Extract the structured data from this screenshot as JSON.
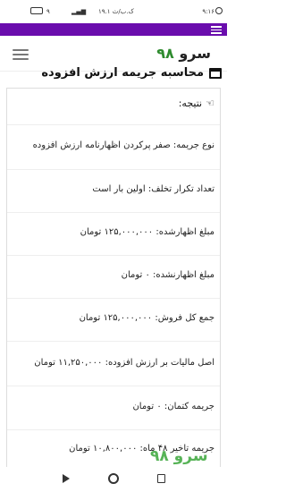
{
  "status_bar": {
    "time": "۹:۱۶",
    "network_speed": "۱۹.۱ ک.ب/ث",
    "battery": "۹"
  },
  "header": {
    "logo_text": "سرو",
    "logo_number": "۹۸",
    "menu_icon": "hamburger-icon"
  },
  "page": {
    "title": "محاسبه جریمه ارزش افزوده",
    "title_icon": "window-icon"
  },
  "result": {
    "heading": "نتیجه:",
    "heading_icon": "pointing-hand-icon",
    "rows": [
      "نوع جریمه: صفر پرکردن اظهارنامه ارزش افزوده",
      "تعداد تکرار تخلف: اولین بار است",
      "مبلغ اظهارشده: ۱۲۵,۰۰۰,۰۰۰ تومان",
      "مبلغ اظهارنشده: ۰ تومان",
      "جمع کل فروش: ۱۲۵,۰۰۰,۰۰۰ تومان",
      "اصل مالیات بر ارزش افزوده: ۱۱,۲۵۰,۰۰۰ تومان",
      "جریمه کتمان: ۰ تومان",
      "جریمه تاخیر ۴۸ ماه: ۱۰,۸۰۰,۰۰۰ تومان"
    ]
  },
  "watermark": "سرو ۹۸",
  "colors": {
    "accent": "#6a0dad",
    "logo_green": "#2e8b2e"
  }
}
